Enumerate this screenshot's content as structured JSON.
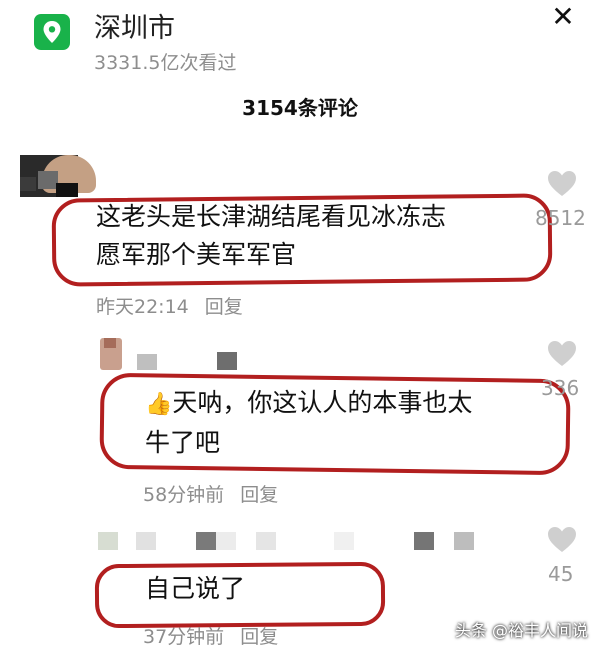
{
  "location": {
    "name": "深圳市",
    "views": "3331.5亿次看过"
  },
  "header": {
    "close_label": "✕",
    "comment_count": "3154条评论"
  },
  "comments": [
    {
      "text_line1": "这老头是长津湖结尾看见冰冻志",
      "text_line2": "愿军那个美军军官",
      "time": "昨天22:14",
      "reply_label": "回复",
      "likes": "8512"
    },
    {
      "emoji": "👍",
      "text_line1": "天呐，你这认人的本事也太",
      "text_line2": "牛了吧",
      "time": "58分钟前",
      "reply_label": "回复",
      "likes": "336"
    },
    {
      "text_line1": "自己说了",
      "time": "37分钟前",
      "reply_label": "回复",
      "likes": "45"
    }
  ],
  "watermark": "头条 @裕丰人间说",
  "colors": {
    "accent_green": "#19b24a",
    "annotation_red": "#b21f1f",
    "muted_text": "#8d8d8d"
  },
  "icons": [
    "location-pin-icon",
    "close-icon",
    "heart-icon",
    "thumbs-up-emoji"
  ]
}
